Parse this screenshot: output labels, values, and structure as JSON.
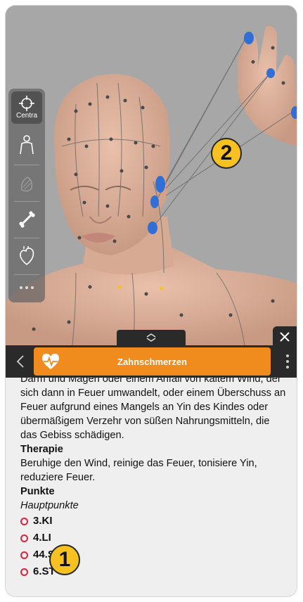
{
  "toolbar": {
    "title": "Zahnschmerzen"
  },
  "tools": {
    "center_label": "Centra"
  },
  "callouts": [
    "1",
    "2"
  ],
  "content": {
    "intro_text": "Darm und Magen oder einem Anfall von kaltem Wind, der sich dann in Feuer umwandelt, oder einem Überschuss an Feuer aufgrund eines Mangels an Yin des Kindes oder übermäßigem Verzehr von süßen Nahrungsmitteln, die das Gebiss schädigen.",
    "therapy_heading": "Therapie",
    "therapy_text": "Beruhige den Wind, reinige das Feuer, tonisiere Yin, reduziere Feuer.",
    "points_heading": "Punkte",
    "points_subheading": "Hauptpunkte",
    "points": [
      "3.KI",
      "4.LI",
      "44.ST",
      "6.ST"
    ]
  },
  "colors": {
    "accent": "#f08b1d",
    "point_highlight": "#2f6fd6",
    "point_ring": "#e0203c",
    "callout": "#f7c221"
  },
  "icons": {
    "center": "crosshair-icon",
    "body": "body-icon",
    "muscle": "muscle-icon",
    "bone": "bone-icon",
    "organ": "heart-organ-icon",
    "more": "more-icon",
    "back": "chevron-left-icon",
    "close": "close-icon",
    "handle": "expand-chevrons-icon",
    "title": "heartbeat-icon"
  }
}
